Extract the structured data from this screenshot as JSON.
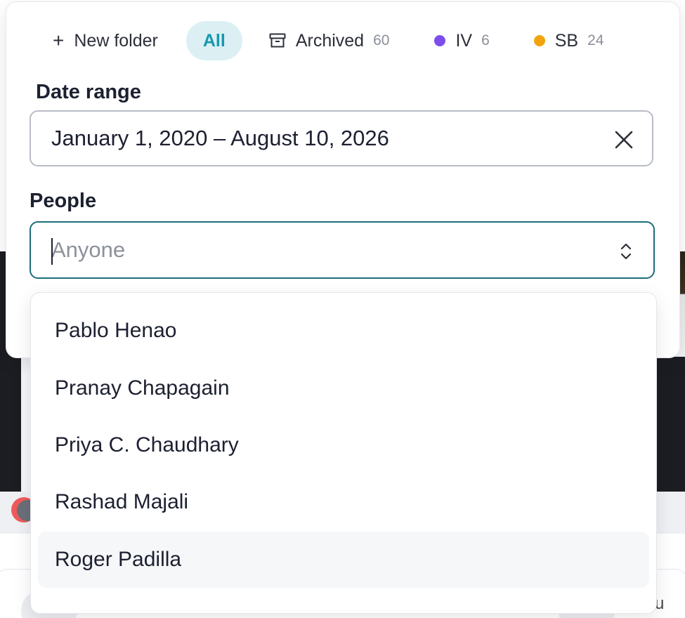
{
  "tabs": {
    "new_folder": "New folder",
    "all": "All",
    "archived": {
      "label": "Archived",
      "count": "60"
    },
    "iv": {
      "label": "IV",
      "count": "6",
      "color": "#7c4dea"
    },
    "sb": {
      "label": "SB",
      "count": "24",
      "color": "#f2a40e"
    }
  },
  "date_range": {
    "label": "Date range",
    "value": "January 1, 2020 – August 10, 2026"
  },
  "people": {
    "label": "People",
    "placeholder": "Anyone",
    "options": [
      "Pablo Henao",
      "Pranay Chapagain",
      "Priya C. Chaudhary",
      "Rashad Majali",
      "Roger Padilla"
    ],
    "highlighted_index": 4
  },
  "background": {
    "edge_text": "u"
  },
  "colors": {
    "accent": "#1b6d7a",
    "all_tab_bg": "#dcf0f4",
    "all_tab_text": "#1798b1"
  }
}
